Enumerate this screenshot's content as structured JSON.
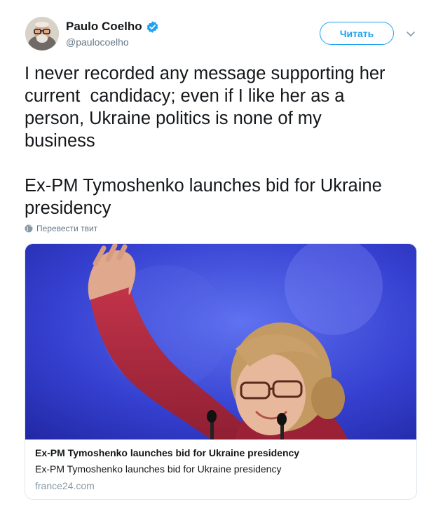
{
  "user": {
    "name": "Paulo Coelho",
    "handle": "@paulocoelho",
    "verified": true
  },
  "follow_button": {
    "label": "Читать"
  },
  "tweet": {
    "text": "I never recorded any message supporting her\ncurrent  candidacy; even if I like her as a\nperson, Ukraine politics is none of my\nbusiness\n\nEx-PM Tymoshenko launches bid for Ukraine\npresidency"
  },
  "translate": {
    "label": "Перевести твит"
  },
  "card": {
    "title": "Ex-PM Tymoshenko launches bid for Ukraine presidency",
    "description": "Ex-PM Tymoshenko launches bid for Ukraine presidency",
    "domain": "france24.com"
  },
  "colors": {
    "accent": "#1da1f2",
    "text": "#14171a",
    "secondary": "#657786",
    "border": "#e1e8ed",
    "photo_background": "#2f37c8"
  },
  "icons": [
    "verified-badge-icon",
    "chevron-down-icon",
    "globe-icon"
  ]
}
